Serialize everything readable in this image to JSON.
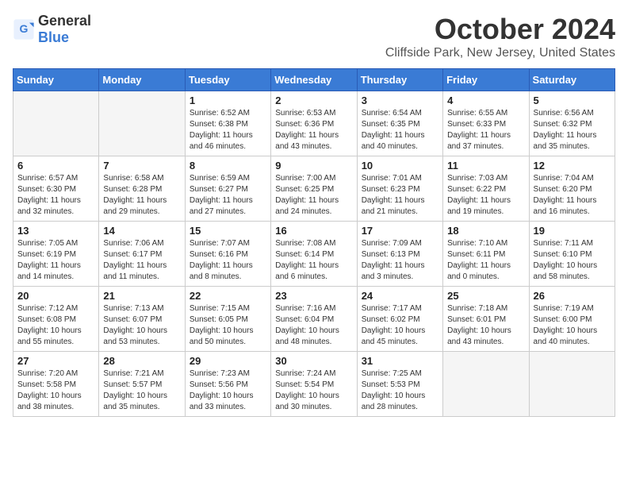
{
  "header": {
    "logo_general": "General",
    "logo_blue": "Blue",
    "month": "October 2024",
    "location": "Cliffside Park, New Jersey, United States"
  },
  "weekdays": [
    "Sunday",
    "Monday",
    "Tuesday",
    "Wednesday",
    "Thursday",
    "Friday",
    "Saturday"
  ],
  "weeks": [
    [
      {
        "day": "",
        "empty": true
      },
      {
        "day": "",
        "empty": true
      },
      {
        "day": "1",
        "sunrise": "6:52 AM",
        "sunset": "6:38 PM",
        "daylight": "11 hours and 46 minutes."
      },
      {
        "day": "2",
        "sunrise": "6:53 AM",
        "sunset": "6:36 PM",
        "daylight": "11 hours and 43 minutes."
      },
      {
        "day": "3",
        "sunrise": "6:54 AM",
        "sunset": "6:35 PM",
        "daylight": "11 hours and 40 minutes."
      },
      {
        "day": "4",
        "sunrise": "6:55 AM",
        "sunset": "6:33 PM",
        "daylight": "11 hours and 37 minutes."
      },
      {
        "day": "5",
        "sunrise": "6:56 AM",
        "sunset": "6:32 PM",
        "daylight": "11 hours and 35 minutes."
      }
    ],
    [
      {
        "day": "6",
        "sunrise": "6:57 AM",
        "sunset": "6:30 PM",
        "daylight": "11 hours and 32 minutes."
      },
      {
        "day": "7",
        "sunrise": "6:58 AM",
        "sunset": "6:28 PM",
        "daylight": "11 hours and 29 minutes."
      },
      {
        "day": "8",
        "sunrise": "6:59 AM",
        "sunset": "6:27 PM",
        "daylight": "11 hours and 27 minutes."
      },
      {
        "day": "9",
        "sunrise": "7:00 AM",
        "sunset": "6:25 PM",
        "daylight": "11 hours and 24 minutes."
      },
      {
        "day": "10",
        "sunrise": "7:01 AM",
        "sunset": "6:23 PM",
        "daylight": "11 hours and 21 minutes."
      },
      {
        "day": "11",
        "sunrise": "7:03 AM",
        "sunset": "6:22 PM",
        "daylight": "11 hours and 19 minutes."
      },
      {
        "day": "12",
        "sunrise": "7:04 AM",
        "sunset": "6:20 PM",
        "daylight": "11 hours and 16 minutes."
      }
    ],
    [
      {
        "day": "13",
        "sunrise": "7:05 AM",
        "sunset": "6:19 PM",
        "daylight": "11 hours and 14 minutes."
      },
      {
        "day": "14",
        "sunrise": "7:06 AM",
        "sunset": "6:17 PM",
        "daylight": "11 hours and 11 minutes."
      },
      {
        "day": "15",
        "sunrise": "7:07 AM",
        "sunset": "6:16 PM",
        "daylight": "11 hours and 8 minutes."
      },
      {
        "day": "16",
        "sunrise": "7:08 AM",
        "sunset": "6:14 PM",
        "daylight": "11 hours and 6 minutes."
      },
      {
        "day": "17",
        "sunrise": "7:09 AM",
        "sunset": "6:13 PM",
        "daylight": "11 hours and 3 minutes."
      },
      {
        "day": "18",
        "sunrise": "7:10 AM",
        "sunset": "6:11 PM",
        "daylight": "11 hours and 0 minutes."
      },
      {
        "day": "19",
        "sunrise": "7:11 AM",
        "sunset": "6:10 PM",
        "daylight": "10 hours and 58 minutes."
      }
    ],
    [
      {
        "day": "20",
        "sunrise": "7:12 AM",
        "sunset": "6:08 PM",
        "daylight": "10 hours and 55 minutes."
      },
      {
        "day": "21",
        "sunrise": "7:13 AM",
        "sunset": "6:07 PM",
        "daylight": "10 hours and 53 minutes."
      },
      {
        "day": "22",
        "sunrise": "7:15 AM",
        "sunset": "6:05 PM",
        "daylight": "10 hours and 50 minutes."
      },
      {
        "day": "23",
        "sunrise": "7:16 AM",
        "sunset": "6:04 PM",
        "daylight": "10 hours and 48 minutes."
      },
      {
        "day": "24",
        "sunrise": "7:17 AM",
        "sunset": "6:02 PM",
        "daylight": "10 hours and 45 minutes."
      },
      {
        "day": "25",
        "sunrise": "7:18 AM",
        "sunset": "6:01 PM",
        "daylight": "10 hours and 43 minutes."
      },
      {
        "day": "26",
        "sunrise": "7:19 AM",
        "sunset": "6:00 PM",
        "daylight": "10 hours and 40 minutes."
      }
    ],
    [
      {
        "day": "27",
        "sunrise": "7:20 AM",
        "sunset": "5:58 PM",
        "daylight": "10 hours and 38 minutes."
      },
      {
        "day": "28",
        "sunrise": "7:21 AM",
        "sunset": "5:57 PM",
        "daylight": "10 hours and 35 minutes."
      },
      {
        "day": "29",
        "sunrise": "7:23 AM",
        "sunset": "5:56 PM",
        "daylight": "10 hours and 33 minutes."
      },
      {
        "day": "30",
        "sunrise": "7:24 AM",
        "sunset": "5:54 PM",
        "daylight": "10 hours and 30 minutes."
      },
      {
        "day": "31",
        "sunrise": "7:25 AM",
        "sunset": "5:53 PM",
        "daylight": "10 hours and 28 minutes."
      },
      {
        "day": "",
        "empty": true
      },
      {
        "day": "",
        "empty": true
      }
    ]
  ]
}
